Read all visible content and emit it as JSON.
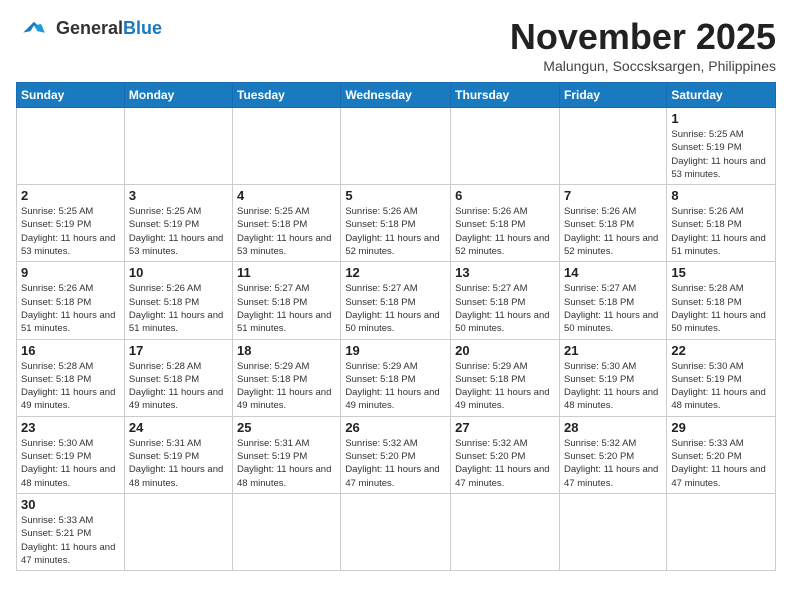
{
  "header": {
    "logo_general": "General",
    "logo_blue": "Blue",
    "month": "November 2025",
    "location": "Malungun, Soccsksargen, Philippines"
  },
  "weekdays": [
    "Sunday",
    "Monday",
    "Tuesday",
    "Wednesday",
    "Thursday",
    "Friday",
    "Saturday"
  ],
  "weeks": [
    [
      {
        "day": "",
        "empty": true
      },
      {
        "day": "",
        "empty": true
      },
      {
        "day": "",
        "empty": true
      },
      {
        "day": "",
        "empty": true
      },
      {
        "day": "",
        "empty": true
      },
      {
        "day": "",
        "empty": true
      },
      {
        "day": "1",
        "sunrise": "Sunrise: 5:25 AM",
        "sunset": "Sunset: 5:19 PM",
        "daylight": "Daylight: 11 hours and 53 minutes."
      }
    ],
    [
      {
        "day": "2",
        "sunrise": "Sunrise: 5:25 AM",
        "sunset": "Sunset: 5:19 PM",
        "daylight": "Daylight: 11 hours and 53 minutes."
      },
      {
        "day": "3",
        "sunrise": "Sunrise: 5:25 AM",
        "sunset": "Sunset: 5:19 PM",
        "daylight": "Daylight: 11 hours and 53 minutes."
      },
      {
        "day": "4",
        "sunrise": "Sunrise: 5:25 AM",
        "sunset": "Sunset: 5:18 PM",
        "daylight": "Daylight: 11 hours and 53 minutes."
      },
      {
        "day": "5",
        "sunrise": "Sunrise: 5:26 AM",
        "sunset": "Sunset: 5:18 PM",
        "daylight": "Daylight: 11 hours and 52 minutes."
      },
      {
        "day": "6",
        "sunrise": "Sunrise: 5:26 AM",
        "sunset": "Sunset: 5:18 PM",
        "daylight": "Daylight: 11 hours and 52 minutes."
      },
      {
        "day": "7",
        "sunrise": "Sunrise: 5:26 AM",
        "sunset": "Sunset: 5:18 PM",
        "daylight": "Daylight: 11 hours and 52 minutes."
      },
      {
        "day": "8",
        "sunrise": "Sunrise: 5:26 AM",
        "sunset": "Sunset: 5:18 PM",
        "daylight": "Daylight: 11 hours and 51 minutes."
      }
    ],
    [
      {
        "day": "9",
        "sunrise": "Sunrise: 5:26 AM",
        "sunset": "Sunset: 5:18 PM",
        "daylight": "Daylight: 11 hours and 51 minutes."
      },
      {
        "day": "10",
        "sunrise": "Sunrise: 5:26 AM",
        "sunset": "Sunset: 5:18 PM",
        "daylight": "Daylight: 11 hours and 51 minutes."
      },
      {
        "day": "11",
        "sunrise": "Sunrise: 5:27 AM",
        "sunset": "Sunset: 5:18 PM",
        "daylight": "Daylight: 11 hours and 51 minutes."
      },
      {
        "day": "12",
        "sunrise": "Sunrise: 5:27 AM",
        "sunset": "Sunset: 5:18 PM",
        "daylight": "Daylight: 11 hours and 50 minutes."
      },
      {
        "day": "13",
        "sunrise": "Sunrise: 5:27 AM",
        "sunset": "Sunset: 5:18 PM",
        "daylight": "Daylight: 11 hours and 50 minutes."
      },
      {
        "day": "14",
        "sunrise": "Sunrise: 5:27 AM",
        "sunset": "Sunset: 5:18 PM",
        "daylight": "Daylight: 11 hours and 50 minutes."
      },
      {
        "day": "15",
        "sunrise": "Sunrise: 5:28 AM",
        "sunset": "Sunset: 5:18 PM",
        "daylight": "Daylight: 11 hours and 50 minutes."
      }
    ],
    [
      {
        "day": "16",
        "sunrise": "Sunrise: 5:28 AM",
        "sunset": "Sunset: 5:18 PM",
        "daylight": "Daylight: 11 hours and 49 minutes."
      },
      {
        "day": "17",
        "sunrise": "Sunrise: 5:28 AM",
        "sunset": "Sunset: 5:18 PM",
        "daylight": "Daylight: 11 hours and 49 minutes."
      },
      {
        "day": "18",
        "sunrise": "Sunrise: 5:29 AM",
        "sunset": "Sunset: 5:18 PM",
        "daylight": "Daylight: 11 hours and 49 minutes."
      },
      {
        "day": "19",
        "sunrise": "Sunrise: 5:29 AM",
        "sunset": "Sunset: 5:18 PM",
        "daylight": "Daylight: 11 hours and 49 minutes."
      },
      {
        "day": "20",
        "sunrise": "Sunrise: 5:29 AM",
        "sunset": "Sunset: 5:18 PM",
        "daylight": "Daylight: 11 hours and 49 minutes."
      },
      {
        "day": "21",
        "sunrise": "Sunrise: 5:30 AM",
        "sunset": "Sunset: 5:19 PM",
        "daylight": "Daylight: 11 hours and 48 minutes."
      },
      {
        "day": "22",
        "sunrise": "Sunrise: 5:30 AM",
        "sunset": "Sunset: 5:19 PM",
        "daylight": "Daylight: 11 hours and 48 minutes."
      }
    ],
    [
      {
        "day": "23",
        "sunrise": "Sunrise: 5:30 AM",
        "sunset": "Sunset: 5:19 PM",
        "daylight": "Daylight: 11 hours and 48 minutes."
      },
      {
        "day": "24",
        "sunrise": "Sunrise: 5:31 AM",
        "sunset": "Sunset: 5:19 PM",
        "daylight": "Daylight: 11 hours and 48 minutes."
      },
      {
        "day": "25",
        "sunrise": "Sunrise: 5:31 AM",
        "sunset": "Sunset: 5:19 PM",
        "daylight": "Daylight: 11 hours and 48 minutes."
      },
      {
        "day": "26",
        "sunrise": "Sunrise: 5:32 AM",
        "sunset": "Sunset: 5:20 PM",
        "daylight": "Daylight: 11 hours and 47 minutes."
      },
      {
        "day": "27",
        "sunrise": "Sunrise: 5:32 AM",
        "sunset": "Sunset: 5:20 PM",
        "daylight": "Daylight: 11 hours and 47 minutes."
      },
      {
        "day": "28",
        "sunrise": "Sunrise: 5:32 AM",
        "sunset": "Sunset: 5:20 PM",
        "daylight": "Daylight: 11 hours and 47 minutes."
      },
      {
        "day": "29",
        "sunrise": "Sunrise: 5:33 AM",
        "sunset": "Sunset: 5:20 PM",
        "daylight": "Daylight: 11 hours and 47 minutes."
      }
    ],
    [
      {
        "day": "30",
        "sunrise": "Sunrise: 5:33 AM",
        "sunset": "Sunset: 5:21 PM",
        "daylight": "Daylight: 11 hours and 47 minutes."
      },
      {
        "day": "",
        "empty": true
      },
      {
        "day": "",
        "empty": true
      },
      {
        "day": "",
        "empty": true
      },
      {
        "day": "",
        "empty": true
      },
      {
        "day": "",
        "empty": true
      },
      {
        "day": "",
        "empty": true
      }
    ]
  ]
}
